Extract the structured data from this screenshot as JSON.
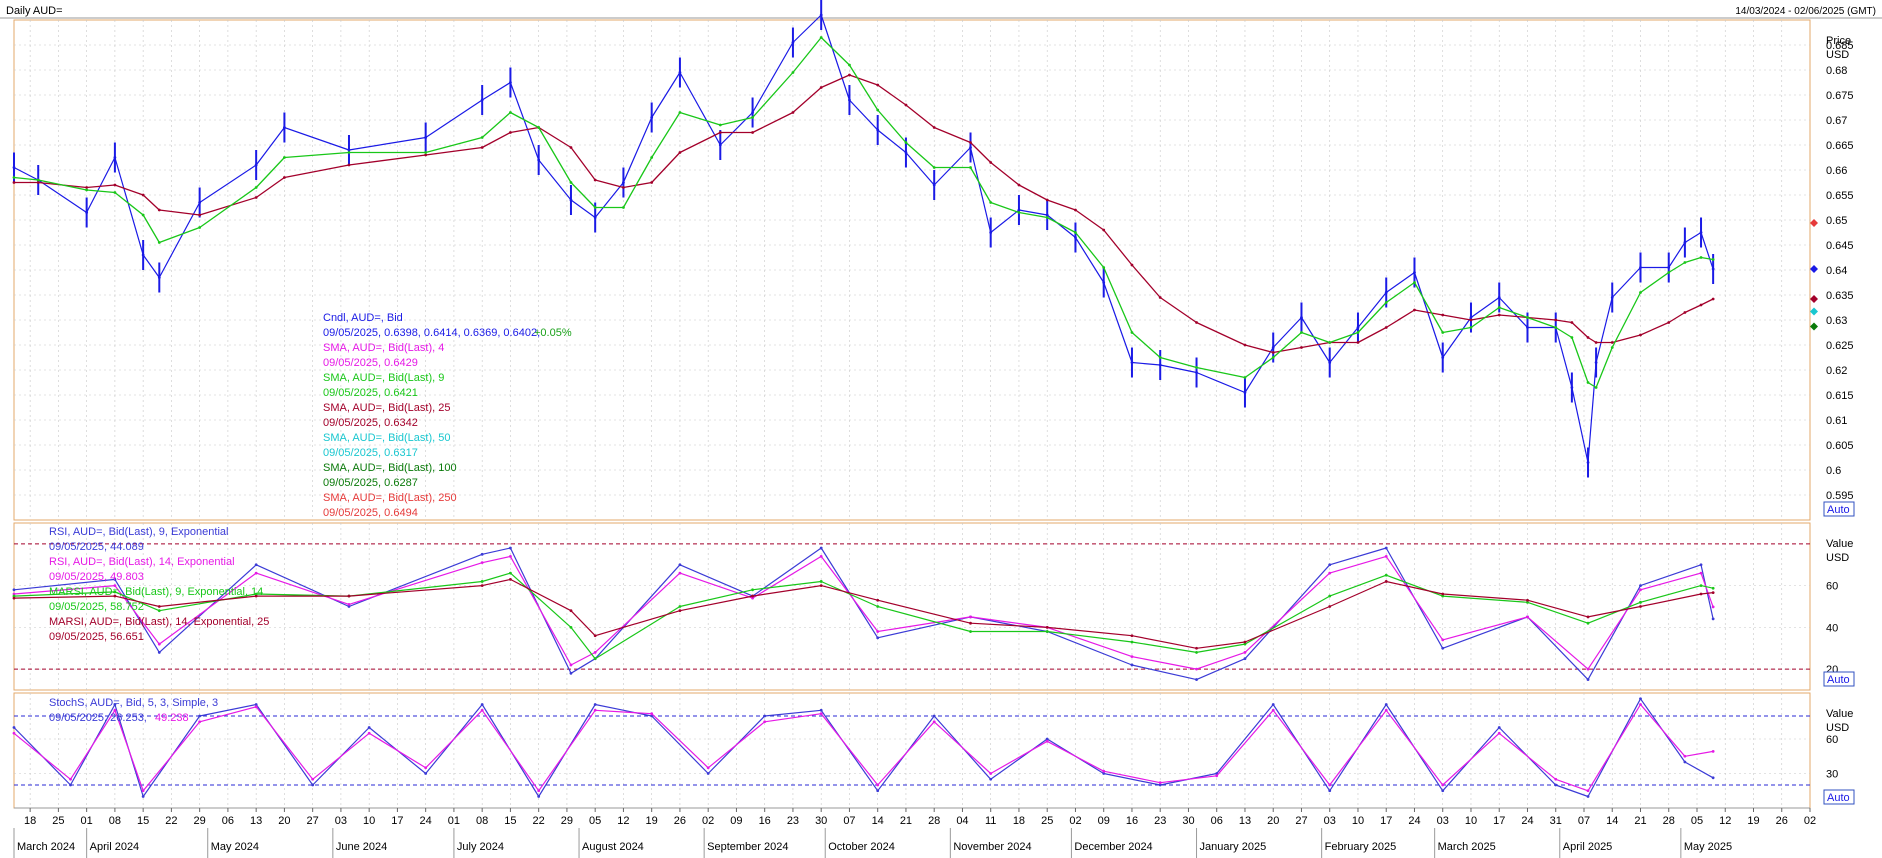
{
  "header": {
    "title": "Daily AUD=",
    "range": "14/03/2024 - 02/06/2025 (GMT)"
  },
  "axes": {
    "price_title": "Price",
    "price_unit": "USD",
    "indicator_title": "Value",
    "indicator_unit": "USD",
    "auto_label": "Auto"
  },
  "colors": {
    "price": "#1a1ae6",
    "sma4": "#e619e6",
    "sma9": "#19c719",
    "sma25": "#a3002b",
    "sma50": "#19c7cf",
    "sma100": "#0a7a0a",
    "sma250": "#e63a3a",
    "rsi9": "#3b3bd6",
    "rsi14": "#e619e6",
    "marsi9": "#19c719",
    "marsi14": "#a3002b",
    "stoch_k": "#3b3bd6",
    "stoch_d": "#e619e6",
    "grid": "#c8c8c8",
    "frame": "#e3a96b"
  },
  "legend_price": [
    {
      "name": "Cndl, AUD=, Bid",
      "value": "09/05/2025, 0.6398, 0.6414, 0.6369, 0.6402,",
      "change": "+0.05%",
      "color": "#1a1ae6",
      "change_color": "#19a019"
    },
    {
      "name": "SMA, AUD=, Bid(Last), 4",
      "value": "09/05/2025, 0.6429",
      "color": "#e619e6"
    },
    {
      "name": "SMA, AUD=, Bid(Last), 9",
      "value": "09/05/2025, 0.6421",
      "color": "#19c719"
    },
    {
      "name": "SMA, AUD=, Bid(Last), 25",
      "value": "09/05/2025, 0.6342",
      "color": "#a3002b"
    },
    {
      "name": "SMA, AUD=, Bid(Last), 50",
      "value": "09/05/2025, 0.6317",
      "color": "#19c7cf"
    },
    {
      "name": "SMA, AUD=, Bid(Last), 100",
      "value": "09/05/2025, 0.6287",
      "color": "#0a7a0a"
    },
    {
      "name": "SMA, AUD=, Bid(Last), 250",
      "value": "09/05/2025, 0.6494",
      "color": "#e63a3a"
    }
  ],
  "legend_rsi": [
    {
      "name": "RSI, AUD=, Bid(Last), 9, Exponential",
      "value": "09/05/2025, 44.089",
      "color": "#3b3bd6"
    },
    {
      "name": "RSI, AUD=, Bid(Last), 14, Exponential",
      "value": "09/05/2025, 49.803",
      "color": "#e619e6"
    },
    {
      "name": "MARSI, AUD=, Bid(Last), 9, Exponential, 14",
      "value": "09/05/2025, 58.752",
      "color": "#19c719"
    },
    {
      "name": "MARSI, AUD=, Bid(Last), 14, Exponential, 25",
      "value": "09/05/2025, 56.651",
      "color": "#a3002b"
    }
  ],
  "legend_stoch": [
    {
      "name": "StochS, AUD=, Bid, 5, 3, Simple, 3",
      "value_k": "09/05/2025, 26.253,",
      "value_d": "49.238",
      "color": "#3b3bd6",
      "color_d": "#e619e6"
    }
  ],
  "chart_data": [
    {
      "type": "line",
      "title": "Daily AUD=",
      "ylabel": "Price USD",
      "ylim": [
        0.59,
        0.69
      ],
      "yticks": [
        0.595,
        0.6,
        0.605,
        0.61,
        0.615,
        0.62,
        0.625,
        0.63,
        0.635,
        0.64,
        0.645,
        0.65,
        0.655,
        0.66,
        0.665,
        0.67,
        0.675,
        0.68,
        0.685
      ],
      "ytick_labels": [
        "0.595",
        "0.6",
        "0.605",
        "0.61",
        "0.615",
        "0.62",
        "0.625",
        "0.63",
        "0.635",
        "0.64",
        "0.645",
        "0.65",
        "0.655",
        "0.66",
        "0.665",
        "0.67",
        "0.675",
        "0.68",
        "0.685"
      ],
      "x": [
        "2024-03-14",
        "2024-03-20",
        "2024-04-01",
        "2024-04-08",
        "2024-04-15",
        "2024-04-19",
        "2024-04-29",
        "2024-05-13",
        "2024-05-20",
        "2024-06-05",
        "2024-06-24",
        "2024-07-08",
        "2024-07-15",
        "2024-07-22",
        "2024-07-30",
        "2024-08-05",
        "2024-08-12",
        "2024-08-19",
        "2024-08-26",
        "2024-09-05",
        "2024-09-13",
        "2024-09-23",
        "2024-09-30",
        "2024-10-07",
        "2024-10-14",
        "2024-10-21",
        "2024-10-28",
        "2024-11-06",
        "2024-11-11",
        "2024-11-18",
        "2024-11-25",
        "2024-12-02",
        "2024-12-09",
        "2024-12-16",
        "2024-12-23",
        "2025-01-01",
        "2025-01-13",
        "2025-01-20",
        "2025-01-27",
        "2025-02-03",
        "2025-02-10",
        "2025-02-17",
        "2025-02-24",
        "2025-03-03",
        "2025-03-10",
        "2025-03-17",
        "2025-03-24",
        "2025-03-31",
        "2025-04-04",
        "2025-04-08",
        "2025-04-10",
        "2025-04-14",
        "2025-04-21",
        "2025-04-28",
        "2025-05-02",
        "2025-05-06",
        "2025-05-09"
      ],
      "series": [
        {
          "name": "Cndl, AUD=, Bid",
          "values": [
            0.6605,
            0.658,
            0.6515,
            0.6625,
            0.643,
            0.6385,
            0.6535,
            0.661,
            0.6685,
            0.664,
            0.6665,
            0.674,
            0.6775,
            0.662,
            0.654,
            0.6505,
            0.6575,
            0.6705,
            0.6795,
            0.665,
            0.6715,
            0.6855,
            0.691,
            0.674,
            0.668,
            0.6635,
            0.657,
            0.6645,
            0.6475,
            0.652,
            0.651,
            0.6465,
            0.6375,
            0.6215,
            0.621,
            0.6195,
            0.6155,
            0.6245,
            0.6305,
            0.6215,
            0.6285,
            0.6355,
            0.6395,
            0.6225,
            0.6305,
            0.6345,
            0.6285,
            0.6285,
            0.6165,
            0.6015,
            0.6215,
            0.6345,
            0.6405,
            0.6405,
            0.6455,
            0.6475,
            0.6402
          ]
        },
        {
          "name": "SMA, AUD=, Bid(Last), 9",
          "values": [
            0.6585,
            0.658,
            0.656,
            0.6555,
            0.651,
            0.6455,
            0.6485,
            0.6565,
            0.6625,
            0.6635,
            0.6635,
            0.6665,
            0.6715,
            0.6685,
            0.6575,
            0.6525,
            0.6525,
            0.6625,
            0.6715,
            0.669,
            0.6705,
            0.6795,
            0.6865,
            0.681,
            0.672,
            0.6655,
            0.6605,
            0.6605,
            0.6535,
            0.6515,
            0.6505,
            0.6475,
            0.6405,
            0.6275,
            0.6225,
            0.6205,
            0.6185,
            0.6225,
            0.6275,
            0.6255,
            0.6275,
            0.6335,
            0.6375,
            0.6275,
            0.6285,
            0.6325,
            0.6305,
            0.6285,
            0.6265,
            0.6175,
            0.6165,
            0.6245,
            0.6355,
            0.6395,
            0.6415,
            0.6425,
            0.6421
          ]
        },
        {
          "name": "SMA, AUD=, Bid(Last), 25",
          "values": [
            0.6575,
            0.6575,
            0.6565,
            0.657,
            0.655,
            0.652,
            0.651,
            0.6545,
            0.6585,
            0.661,
            0.663,
            0.6645,
            0.6675,
            0.6685,
            0.6645,
            0.658,
            0.6565,
            0.6575,
            0.6635,
            0.6675,
            0.6675,
            0.6715,
            0.6765,
            0.679,
            0.677,
            0.673,
            0.6685,
            0.6655,
            0.6615,
            0.657,
            0.654,
            0.652,
            0.648,
            0.641,
            0.6345,
            0.6295,
            0.625,
            0.6235,
            0.6245,
            0.6255,
            0.6255,
            0.6285,
            0.632,
            0.631,
            0.63,
            0.631,
            0.6305,
            0.63,
            0.6295,
            0.6265,
            0.6255,
            0.6255,
            0.627,
            0.6295,
            0.6315,
            0.633,
            0.6342
          ]
        }
      ]
    },
    {
      "type": "line",
      "title": "RSI",
      "ylabel": "Value USD",
      "ylim": [
        10,
        90
      ],
      "yticks": [
        20,
        40,
        60
      ],
      "ytick_labels": [
        "20",
        "40",
        "60"
      ],
      "reference_lines": [
        20,
        80
      ],
      "x": [
        "2024-03-14",
        "2024-04-08",
        "2024-04-19",
        "2024-05-13",
        "2024-06-05",
        "2024-07-08",
        "2024-07-15",
        "2024-07-30",
        "2024-08-05",
        "2024-08-26",
        "2024-09-13",
        "2024-09-30",
        "2024-10-14",
        "2024-11-06",
        "2024-11-25",
        "2024-12-16",
        "2025-01-01",
        "2025-01-13",
        "2025-02-03",
        "2025-02-17",
        "2025-03-03",
        "2025-03-24",
        "2025-04-08",
        "2025-04-21",
        "2025-05-06",
        "2025-05-09"
      ],
      "series": [
        {
          "name": "RSI, AUD=, Bid(Last), 9, Exponential",
          "values": [
            58,
            63,
            28,
            70,
            50,
            75,
            78,
            18,
            25,
            70,
            55,
            78,
            35,
            45,
            38,
            22,
            15,
            25,
            70,
            78,
            30,
            45,
            15,
            60,
            70,
            44.089
          ]
        },
        {
          "name": "RSI, AUD=, Bid(Last), 14, Exponential",
          "values": [
            56,
            60,
            32,
            66,
            51,
            71,
            74,
            22,
            28,
            66,
            54,
            74,
            38,
            45,
            40,
            26,
            20,
            28,
            66,
            74,
            34,
            45,
            20,
            58,
            66,
            49.803
          ]
        },
        {
          "name": "MARSI, AUD=, Bid(Last), 9, Exponential, 14",
          "values": [
            55,
            57,
            48,
            56,
            55,
            62,
            66,
            40,
            25,
            50,
            58,
            62,
            50,
            38,
            38,
            33,
            28,
            32,
            55,
            65,
            55,
            52,
            42,
            52,
            60,
            58.752
          ]
        },
        {
          "name": "MARSI, AUD=, Bid(Last), 14, Exponential, 25",
          "values": [
            54,
            55,
            50,
            55,
            55,
            60,
            63,
            48,
            36,
            48,
            55,
            60,
            53,
            42,
            40,
            36,
            30,
            33,
            50,
            62,
            56,
            53,
            45,
            50,
            56,
            56.651
          ]
        }
      ]
    },
    {
      "type": "line",
      "title": "StochS",
      "ylabel": "Value USD",
      "ylim": [
        0,
        100
      ],
      "yticks": [
        30,
        60
      ],
      "ytick_labels": [
        "30",
        "60"
      ],
      "reference_lines": [
        20,
        80
      ],
      "x": [
        "2024-03-14",
        "2024-03-28",
        "2024-04-08",
        "2024-04-15",
        "2024-04-29",
        "2024-05-13",
        "2024-05-27",
        "2024-06-10",
        "2024-06-24",
        "2024-07-08",
        "2024-07-22",
        "2024-08-05",
        "2024-08-19",
        "2024-09-02",
        "2024-09-16",
        "2024-09-30",
        "2024-10-14",
        "2024-10-28",
        "2024-11-11",
        "2024-11-25",
        "2024-12-09",
        "2024-12-23",
        "2025-01-06",
        "2025-01-20",
        "2025-02-03",
        "2025-02-17",
        "2025-03-03",
        "2025-03-17",
        "2025-03-31",
        "2025-04-08",
        "2025-04-21",
        "2025-05-02",
        "2025-05-09"
      ],
      "series": [
        {
          "name": "StochS %K",
          "values": [
            70,
            20,
            90,
            10,
            80,
            90,
            20,
            70,
            30,
            90,
            10,
            90,
            80,
            30,
            80,
            85,
            15,
            80,
            25,
            60,
            30,
            20,
            30,
            90,
            15,
            90,
            15,
            70,
            20,
            10,
            95,
            40,
            26.253
          ]
        },
        {
          "name": "StochS %D",
          "values": [
            65,
            25,
            85,
            15,
            75,
            88,
            25,
            65,
            35,
            85,
            15,
            85,
            82,
            35,
            75,
            82,
            20,
            75,
            30,
            58,
            32,
            22,
            28,
            85,
            20,
            85,
            20,
            65,
            25,
            15,
            90,
            45,
            49.238
          ]
        }
      ]
    }
  ],
  "x_axis": {
    "day_labels": [
      "18",
      "25",
      "01",
      "08",
      "15",
      "22",
      "29",
      "06",
      "13",
      "20",
      "27",
      "03",
      "10",
      "17",
      "24",
      "01",
      "08",
      "15",
      "22",
      "29",
      "05",
      "12",
      "19",
      "26",
      "02",
      "09",
      "16",
      "23",
      "30",
      "07",
      "14",
      "21",
      "28",
      "04",
      "11",
      "18",
      "25",
      "02",
      "09",
      "16",
      "23",
      "30",
      "06",
      "13",
      "20",
      "27",
      "03",
      "10",
      "17",
      "24",
      "03",
      "10",
      "17",
      "24",
      "31",
      "07",
      "14",
      "21",
      "28",
      "05",
      "12",
      "19",
      "26",
      "02"
    ],
    "month_labels": [
      "March 2024",
      "April 2024",
      "May 2024",
      "June 2024",
      "July 2024",
      "August 2024",
      "September 2024",
      "October 2024",
      "November 2024",
      "December 2024",
      "January 2025",
      "February 2025",
      "March 2025",
      "April 2025",
      "May 2025"
    ]
  }
}
